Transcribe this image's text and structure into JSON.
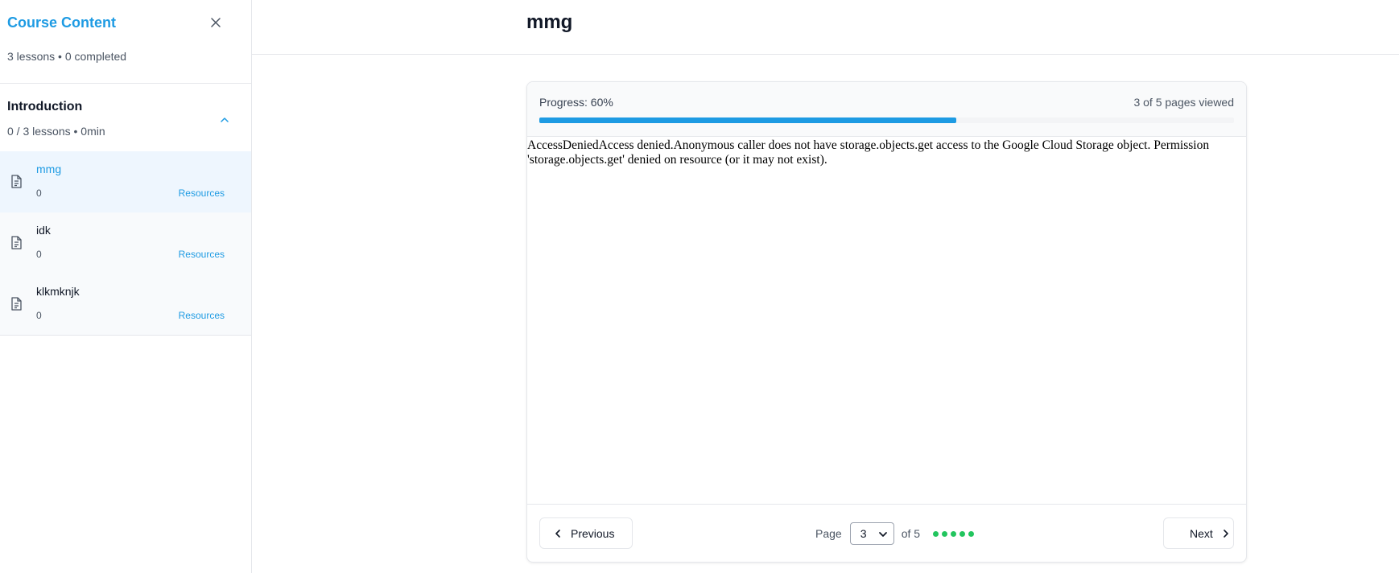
{
  "sidebar": {
    "title": "Course Content",
    "summary": "3 lessons • 0 completed",
    "section": {
      "title": "Introduction",
      "meta": "0 / 3 lessons • 0min"
    },
    "lessons": [
      {
        "title": "mmg",
        "count": "0",
        "resources": "Resources",
        "active": true
      },
      {
        "title": "idk",
        "count": "0",
        "resources": "Resources",
        "active": false
      },
      {
        "title": "klkmknjk",
        "count": "0",
        "resources": "Resources",
        "active": false
      }
    ]
  },
  "main": {
    "title": "mmg",
    "progress": {
      "label": "Progress: 60%",
      "value_percent": 60,
      "count_text": "3 of 5 pages viewed"
    },
    "document_text": "AccessDeniedAccess denied.Anonymous caller does not have storage.objects.get access to the Google Cloud Storage object. Permission 'storage.objects.get' denied on resource (or it may not exist).",
    "pager": {
      "previous_label": "Previous",
      "next_label": "Next",
      "page_label": "Page",
      "current_page": "3",
      "of_label": "of 5",
      "dot_count": 5,
      "dot_color": "#22c55e"
    }
  },
  "colors": {
    "accent": "#1e9be3",
    "active_lesson_bg": "#eef6fe"
  }
}
